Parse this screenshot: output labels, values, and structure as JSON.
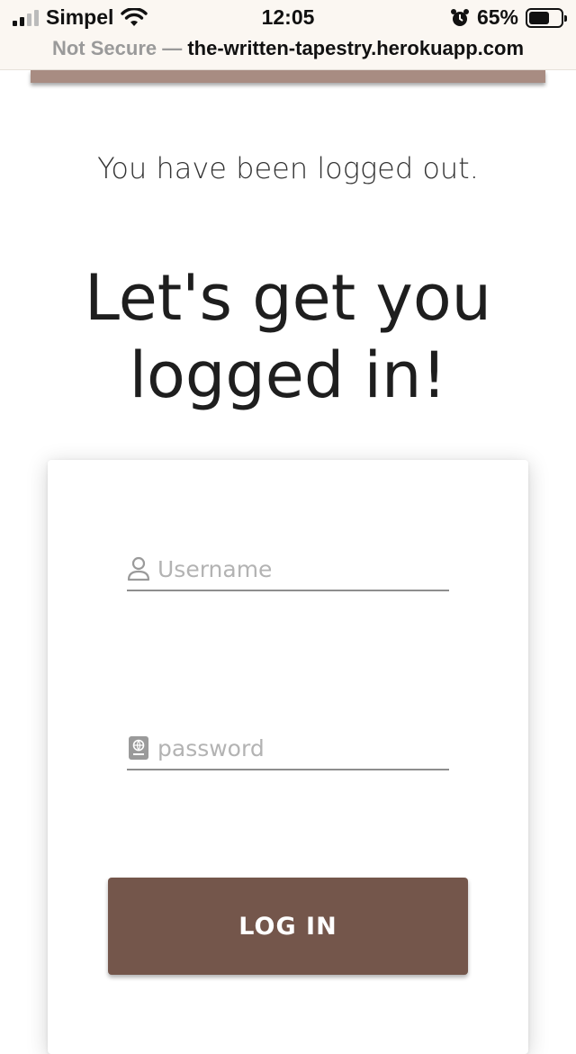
{
  "statusbar": {
    "carrier": "Simpel",
    "time": "12:05",
    "battery_percent": "65%",
    "battery_level": 0.65
  },
  "urlbar": {
    "security": "Not Secure —",
    "domain": "the-written-tapestry.herokuapp.com"
  },
  "page": {
    "message": "You have been logged out.",
    "heading": "Let's get you logged in!"
  },
  "form": {
    "username_placeholder": "Username",
    "username_value": "",
    "password_placeholder": "password",
    "password_value": "",
    "submit_label": "LOG IN"
  },
  "colors": {
    "accent": "#74564b",
    "navbar": "#a88c82",
    "statusbar_bg": "#fbf7f2"
  },
  "icons": {
    "username": "user-icon",
    "password": "passport-icon"
  }
}
